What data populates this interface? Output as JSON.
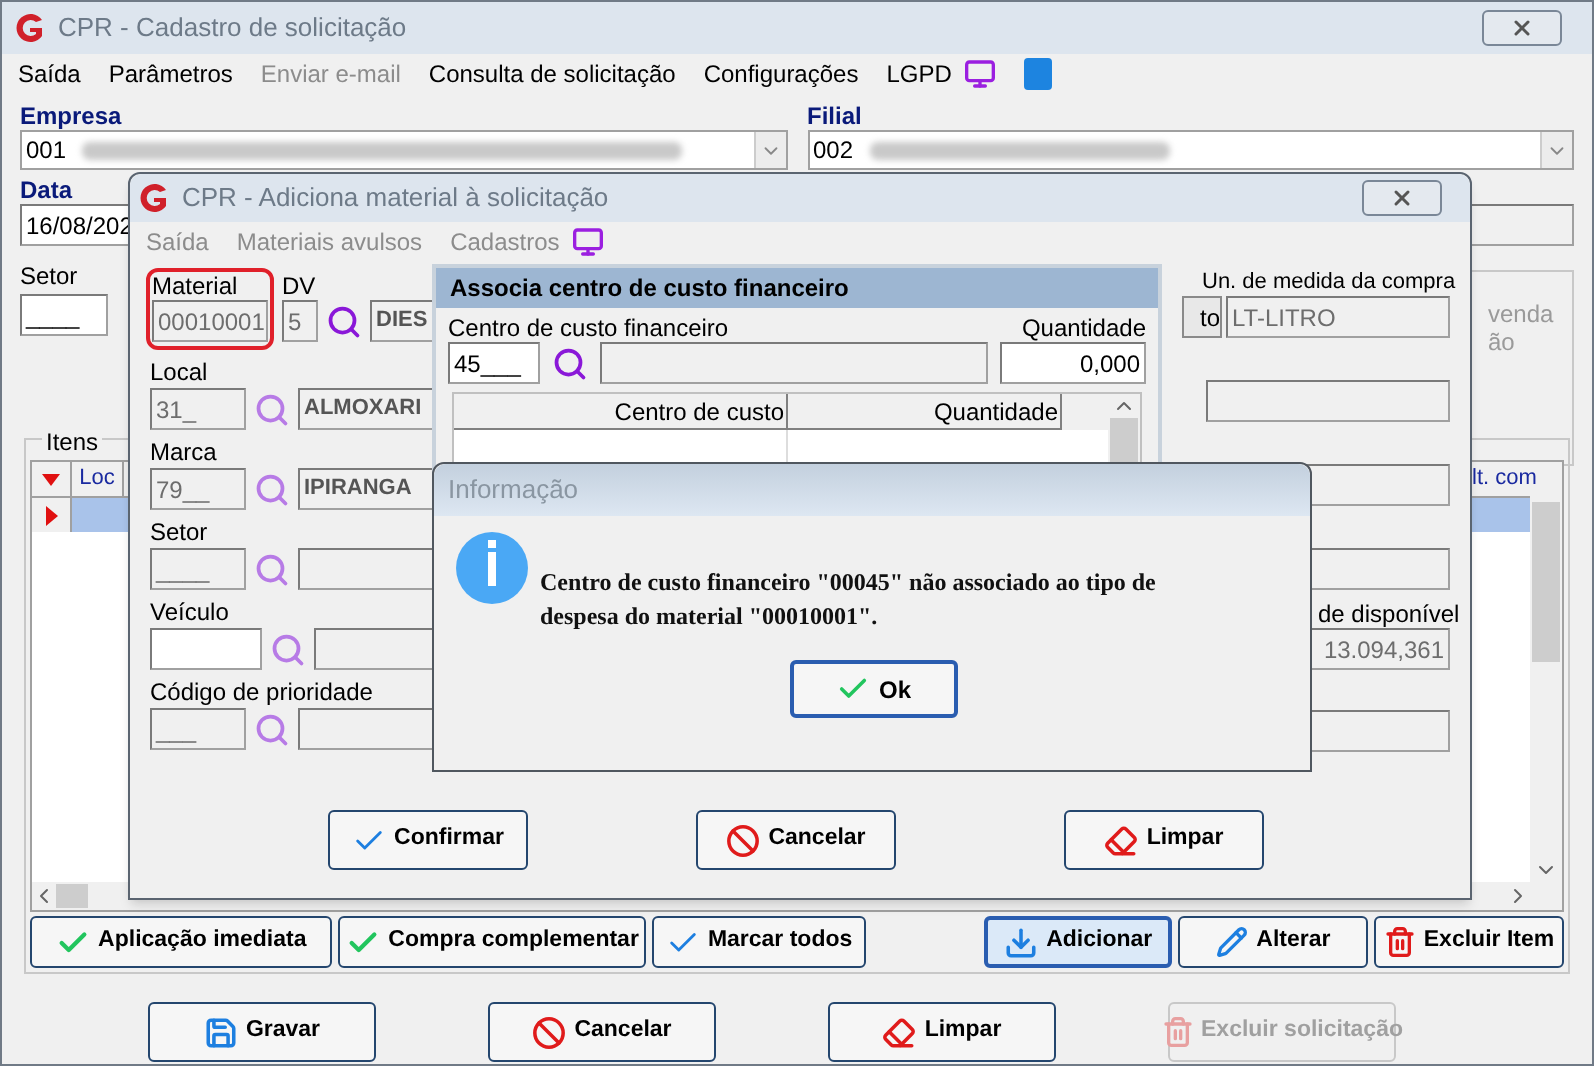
{
  "main_window": {
    "title": "CPR - Cadastro de solicitação",
    "menu": [
      {
        "label": "Saída",
        "disabled": false
      },
      {
        "label": "Parâmetros",
        "disabled": false
      },
      {
        "label": "Enviar e-mail",
        "disabled": true
      },
      {
        "label": "Consulta de solicitação",
        "disabled": false
      },
      {
        "label": "Configurações",
        "disabled": false
      },
      {
        "label": "LGPD",
        "disabled": false
      }
    ],
    "empresa": {
      "label": "Empresa",
      "value": "001"
    },
    "filial": {
      "label": "Filial",
      "value": "002"
    },
    "data": {
      "label": "Data",
      "value": "16/08/202"
    },
    "setor": {
      "label": "Setor",
      "value": "____"
    },
    "side_group": {
      "lines": [
        "venda",
        "ão"
      ]
    },
    "items": {
      "title": "Itens",
      "columns": [
        "Loc",
        "lt. com"
      ]
    },
    "item_buttons": [
      {
        "label": "Aplicação imediata",
        "kind": "check",
        "selected": false
      },
      {
        "label": "Compra complementar",
        "kind": "check",
        "selected": false
      },
      {
        "label": "Marcar todos",
        "kind": "tick",
        "selected": false
      },
      {
        "label": "Adicionar",
        "kind": "add",
        "selected": true
      },
      {
        "label": "Alterar",
        "kind": "edit",
        "selected": false
      },
      {
        "label": "Excluir Item",
        "kind": "delete",
        "selected": false
      }
    ],
    "buttons": [
      {
        "label": "Gravar",
        "kind": "save",
        "disabled": false
      },
      {
        "label": "Cancelar",
        "kind": "cancel",
        "disabled": false
      },
      {
        "label": "Limpar",
        "kind": "eraser",
        "disabled": false
      },
      {
        "label": "Excluir solicitação",
        "kind": "delete",
        "disabled": true
      }
    ]
  },
  "material_dialog": {
    "title": "CPR - Adiciona material à solicitação",
    "menu": [
      "Saída",
      "Materiais avulsos",
      "Cadastros"
    ],
    "material": {
      "label": "Material",
      "value": "00010001",
      "highlighted": true
    },
    "dv": {
      "label": "DV",
      "value": "5"
    },
    "material_description": "DIES",
    "rows": [
      {
        "label": "Local",
        "code": "31_",
        "description": "ALMOXARI"
      },
      {
        "label": "Marca",
        "code": "79__",
        "description": "IPIRANGA"
      },
      {
        "label": "Setor",
        "code": "____"
      },
      {
        "label": "Veículo"
      },
      {
        "label": "Código de prioridade",
        "code": "___"
      }
    ],
    "partial_button": "to",
    "unit": {
      "label": "Un. de medida da compra",
      "value": "LT-LITRO"
    },
    "available": {
      "label": "de disponível",
      "value": "13.094,361"
    },
    "buttons": [
      {
        "label": "Confirmar",
        "kind": "tick"
      },
      {
        "label": "Cancelar",
        "kind": "cancel"
      },
      {
        "label": "Limpar",
        "kind": "eraser"
      }
    ]
  },
  "cost_center_dialog": {
    "title": "Associa centro de custo financeiro",
    "center": {
      "label": "Centro de custo financeiro",
      "value": "45___"
    },
    "quantity": {
      "label": "Quantidade",
      "value": "0,000"
    },
    "columns": [
      "Centro de custo",
      "Quantidade"
    ]
  },
  "info_dialog": {
    "title": "Informação",
    "message": "Centro de custo financeiro \"00045\" não associado ao tipo de despesa do material \"00010001\".",
    "button": "Ok"
  }
}
